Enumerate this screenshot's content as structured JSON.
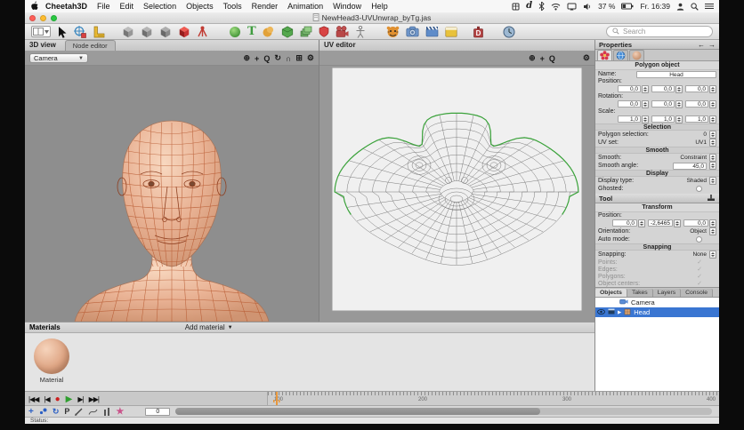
{
  "menu_bar": {
    "items": [
      "Cheetah3D",
      "File",
      "Edit",
      "Selection",
      "Objects",
      "Tools",
      "Render",
      "Animation",
      "Window",
      "Help"
    ],
    "status_icons_left": [
      "app-grid-icon",
      "d-app-icon",
      "bluetooth-icon",
      "wifi-icon",
      "display-icon",
      "volume-icon"
    ],
    "status": {
      "battery": "37 %",
      "clock": "Fr. 16:39"
    },
    "status_icons_right": [
      "user-icon",
      "spotlight-search-icon",
      "notification-list-icon"
    ]
  },
  "window": {
    "title": "NewHead3-UVUnwrap_byTg.jas"
  },
  "toolbar": {
    "search_placeholder": "Search",
    "icons": [
      "view-layout",
      "select-arrow",
      "move-globe",
      "ruler",
      "point-mode-cube",
      "edge-mode-cube",
      "polygon-mode-cube",
      "object-mode-cube",
      "joint",
      "sphere-primitive",
      "text-primitive",
      "metaball",
      "polyhedron",
      "array-modifier",
      "shield-tag",
      "camera-object",
      "character-rig",
      "render-tiger",
      "render-camera",
      "animation-clapper",
      "uv-window",
      "dynamics-weight",
      "time-clock"
    ]
  },
  "view3d": {
    "label": "3D view",
    "node_editor_label": "Node editor",
    "camera": "Camera"
  },
  "uv_editor": {
    "label": "UV editor"
  },
  "properties": {
    "header": "Properties",
    "rows": [
      {
        "type": "title",
        "text": "Polygon object"
      },
      {
        "type": "namefield",
        "label": "Name:",
        "value": "Head"
      },
      {
        "type": "triple",
        "label": "Position:",
        "values": [
          "0,0",
          "0,0",
          "0,0"
        ]
      },
      {
        "type": "triple",
        "label": "Rotation:",
        "values": [
          "0,0",
          "0,0",
          "0,0"
        ]
      },
      {
        "type": "triple",
        "label": "Scale:",
        "values": [
          "1,0",
          "1,0",
          "1,0"
        ]
      },
      {
        "type": "section",
        "text": "Selection"
      },
      {
        "type": "valstep",
        "label": "Polygon selection:",
        "value": "0"
      },
      {
        "type": "valstep",
        "label": "UV set:",
        "value": "UV1"
      },
      {
        "type": "section",
        "text": "Smooth"
      },
      {
        "type": "valstep",
        "label": "Smooth:",
        "value": "Constraint"
      },
      {
        "type": "fieldstep",
        "label": "Smooth angle:",
        "value": "45,0"
      },
      {
        "type": "section",
        "text": "Display"
      },
      {
        "type": "valstep",
        "label": "Display type:",
        "value": "Shaded"
      },
      {
        "type": "check",
        "label": "Ghosted:"
      }
    ]
  },
  "tool": {
    "header": "Tool",
    "rows": [
      {
        "type": "title",
        "text": "Transform"
      },
      {
        "type": "triple",
        "label": "Position:",
        "values": [
          "0,0",
          "-2,6465",
          "0,0"
        ]
      },
      {
        "type": "valstep",
        "label": "Orientation:",
        "value": "Object"
      },
      {
        "type": "check",
        "label": "Auto mode:"
      },
      {
        "type": "section",
        "text": "Snapping"
      },
      {
        "type": "valstep",
        "label": "Snapping:",
        "value": "None"
      },
      {
        "type": "graycheck",
        "label": "Points:"
      },
      {
        "type": "graycheck",
        "label": "Edges:"
      },
      {
        "type": "graycheck",
        "label": "Polygons:"
      },
      {
        "type": "graycheck",
        "label": "Object centers:"
      }
    ]
  },
  "scene": {
    "tabs": [
      "Objects",
      "Takes",
      "Layers",
      "Console"
    ],
    "active_tab": "Objects",
    "items": [
      {
        "label": "Camera",
        "selected": false
      },
      {
        "label": "Head",
        "selected": true
      }
    ]
  },
  "materials": {
    "header": "Materials",
    "add_label": "Add material",
    "items": [
      "Material"
    ]
  },
  "timeline": {
    "transport_icons": [
      "go-start",
      "step-back",
      "record",
      "play",
      "step-forward",
      "go-end"
    ],
    "ruler_labels": [
      "100",
      "200",
      "300",
      "400"
    ],
    "frame_field": "0"
  },
  "status_bar": {
    "label": "Status:"
  }
}
